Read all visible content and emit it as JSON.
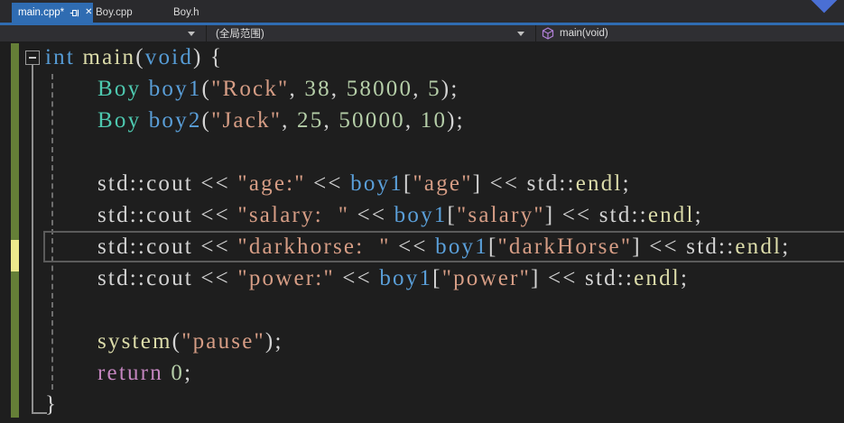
{
  "tabs": {
    "items": [
      {
        "label": "main.cpp*",
        "active": true,
        "pinned": true
      },
      {
        "label": "Boy.cpp",
        "active": false
      },
      {
        "label": "Boy.h",
        "active": false
      }
    ]
  },
  "icons": {
    "pin": "pushpin",
    "close": "✕",
    "dropdown": "triangle-down",
    "method": "purple-cube",
    "fold": "minus-box"
  },
  "navigation_bar": {
    "project_dropdown_value": "",
    "scope_dropdown_value": "(全局范围)",
    "member_dropdown_value": "main(void)"
  },
  "colors": {
    "active_tab": "#2F6CB2",
    "tab_underline": "#2F6CB2",
    "editor_bg": "#1E1E1E",
    "change_tracking_saved": "#657F37",
    "change_tracking_unsaved": "#EDE98C",
    "current_line_border": "#5B5B5B"
  },
  "editor": {
    "current_line_number": 7,
    "unsaved_change_line": 7,
    "token_colors": {
      "keyword": "#569CD6",
      "control": "#C586C0",
      "type": "#4EC9B0",
      "function": "#DCDCAA",
      "variable": "#5A9FD9",
      "string": "#D69D85",
      "number": "#B5CEA8",
      "plain": "#D4D4D4"
    },
    "lines": [
      {
        "indent": 0,
        "segments": [
          {
            "t": "int",
            "c": "keyword"
          },
          {
            "t": " ",
            "c": "plain"
          },
          {
            "t": "main",
            "c": "function"
          },
          {
            "t": "(",
            "c": "plain"
          },
          {
            "t": "void",
            "c": "keyword"
          },
          {
            "t": ") {",
            "c": "plain"
          }
        ]
      },
      {
        "indent": 1,
        "segments": [
          {
            "t": "Boy",
            "c": "type"
          },
          {
            "t": " ",
            "c": "plain"
          },
          {
            "t": "boy1",
            "c": "variable"
          },
          {
            "t": "(",
            "c": "plain"
          },
          {
            "t": "\"Rock\"",
            "c": "string"
          },
          {
            "t": ", ",
            "c": "plain"
          },
          {
            "t": "38",
            "c": "number"
          },
          {
            "t": ", ",
            "c": "plain"
          },
          {
            "t": "58000",
            "c": "number"
          },
          {
            "t": ", ",
            "c": "plain"
          },
          {
            "t": "5",
            "c": "number"
          },
          {
            "t": ");",
            "c": "plain"
          }
        ]
      },
      {
        "indent": 1,
        "segments": [
          {
            "t": "Boy",
            "c": "type"
          },
          {
            "t": " ",
            "c": "plain"
          },
          {
            "t": "boy2",
            "c": "variable"
          },
          {
            "t": "(",
            "c": "plain"
          },
          {
            "t": "\"Jack\"",
            "c": "string"
          },
          {
            "t": ", ",
            "c": "plain"
          },
          {
            "t": "25",
            "c": "number"
          },
          {
            "t": ", ",
            "c": "plain"
          },
          {
            "t": "50000",
            "c": "number"
          },
          {
            "t": ", ",
            "c": "plain"
          },
          {
            "t": "10",
            "c": "number"
          },
          {
            "t": ");",
            "c": "plain"
          }
        ]
      },
      {
        "indent": 1,
        "segments": []
      },
      {
        "indent": 1,
        "segments": [
          {
            "t": "std::cout << ",
            "c": "plain"
          },
          {
            "t": "\"age:\"",
            "c": "string"
          },
          {
            "t": " << ",
            "c": "plain"
          },
          {
            "t": "boy1",
            "c": "variable"
          },
          {
            "t": "[",
            "c": "plain"
          },
          {
            "t": "\"age\"",
            "c": "string"
          },
          {
            "t": "] << std::",
            "c": "plain"
          },
          {
            "t": "endl",
            "c": "function"
          },
          {
            "t": ";",
            "c": "plain"
          }
        ]
      },
      {
        "indent": 1,
        "segments": [
          {
            "t": "std::cout << ",
            "c": "plain"
          },
          {
            "t": "\"salary： \"",
            "c": "string"
          },
          {
            "t": " << ",
            "c": "plain"
          },
          {
            "t": "boy1",
            "c": "variable"
          },
          {
            "t": "[",
            "c": "plain"
          },
          {
            "t": "\"salary\"",
            "c": "string"
          },
          {
            "t": "] << std::",
            "c": "plain"
          },
          {
            "t": "endl",
            "c": "function"
          },
          {
            "t": ";",
            "c": "plain"
          }
        ]
      },
      {
        "indent": 1,
        "segments": [
          {
            "t": "std::cout << ",
            "c": "plain"
          },
          {
            "t": "\"darkhorse： \"",
            "c": "string"
          },
          {
            "t": " << ",
            "c": "plain"
          },
          {
            "t": "boy1",
            "c": "variable"
          },
          {
            "t": "[",
            "c": "plain"
          },
          {
            "t": "\"darkHorse\"",
            "c": "string"
          },
          {
            "t": "] << std::",
            "c": "plain"
          },
          {
            "t": "endl",
            "c": "function"
          },
          {
            "t": ";",
            "c": "plain"
          }
        ]
      },
      {
        "indent": 1,
        "segments": [
          {
            "t": "std::cout << ",
            "c": "plain"
          },
          {
            "t": "\"power:\"",
            "c": "string"
          },
          {
            "t": " << ",
            "c": "plain"
          },
          {
            "t": "boy1",
            "c": "variable"
          },
          {
            "t": "[",
            "c": "plain"
          },
          {
            "t": "\"power\"",
            "c": "string"
          },
          {
            "t": "] << std::",
            "c": "plain"
          },
          {
            "t": "endl",
            "c": "function"
          },
          {
            "t": ";",
            "c": "plain"
          }
        ]
      },
      {
        "indent": 1,
        "segments": []
      },
      {
        "indent": 1,
        "segments": [
          {
            "t": "system",
            "c": "function"
          },
          {
            "t": "(",
            "c": "plain"
          },
          {
            "t": "\"pause\"",
            "c": "string"
          },
          {
            "t": ");",
            "c": "plain"
          }
        ]
      },
      {
        "indent": 1,
        "segments": [
          {
            "t": "return",
            "c": "control"
          },
          {
            "t": " ",
            "c": "plain"
          },
          {
            "t": "0",
            "c": "number"
          },
          {
            "t": ";",
            "c": "plain"
          }
        ]
      },
      {
        "indent": 0,
        "segments": [
          {
            "t": "}",
            "c": "plain"
          }
        ]
      }
    ]
  }
}
